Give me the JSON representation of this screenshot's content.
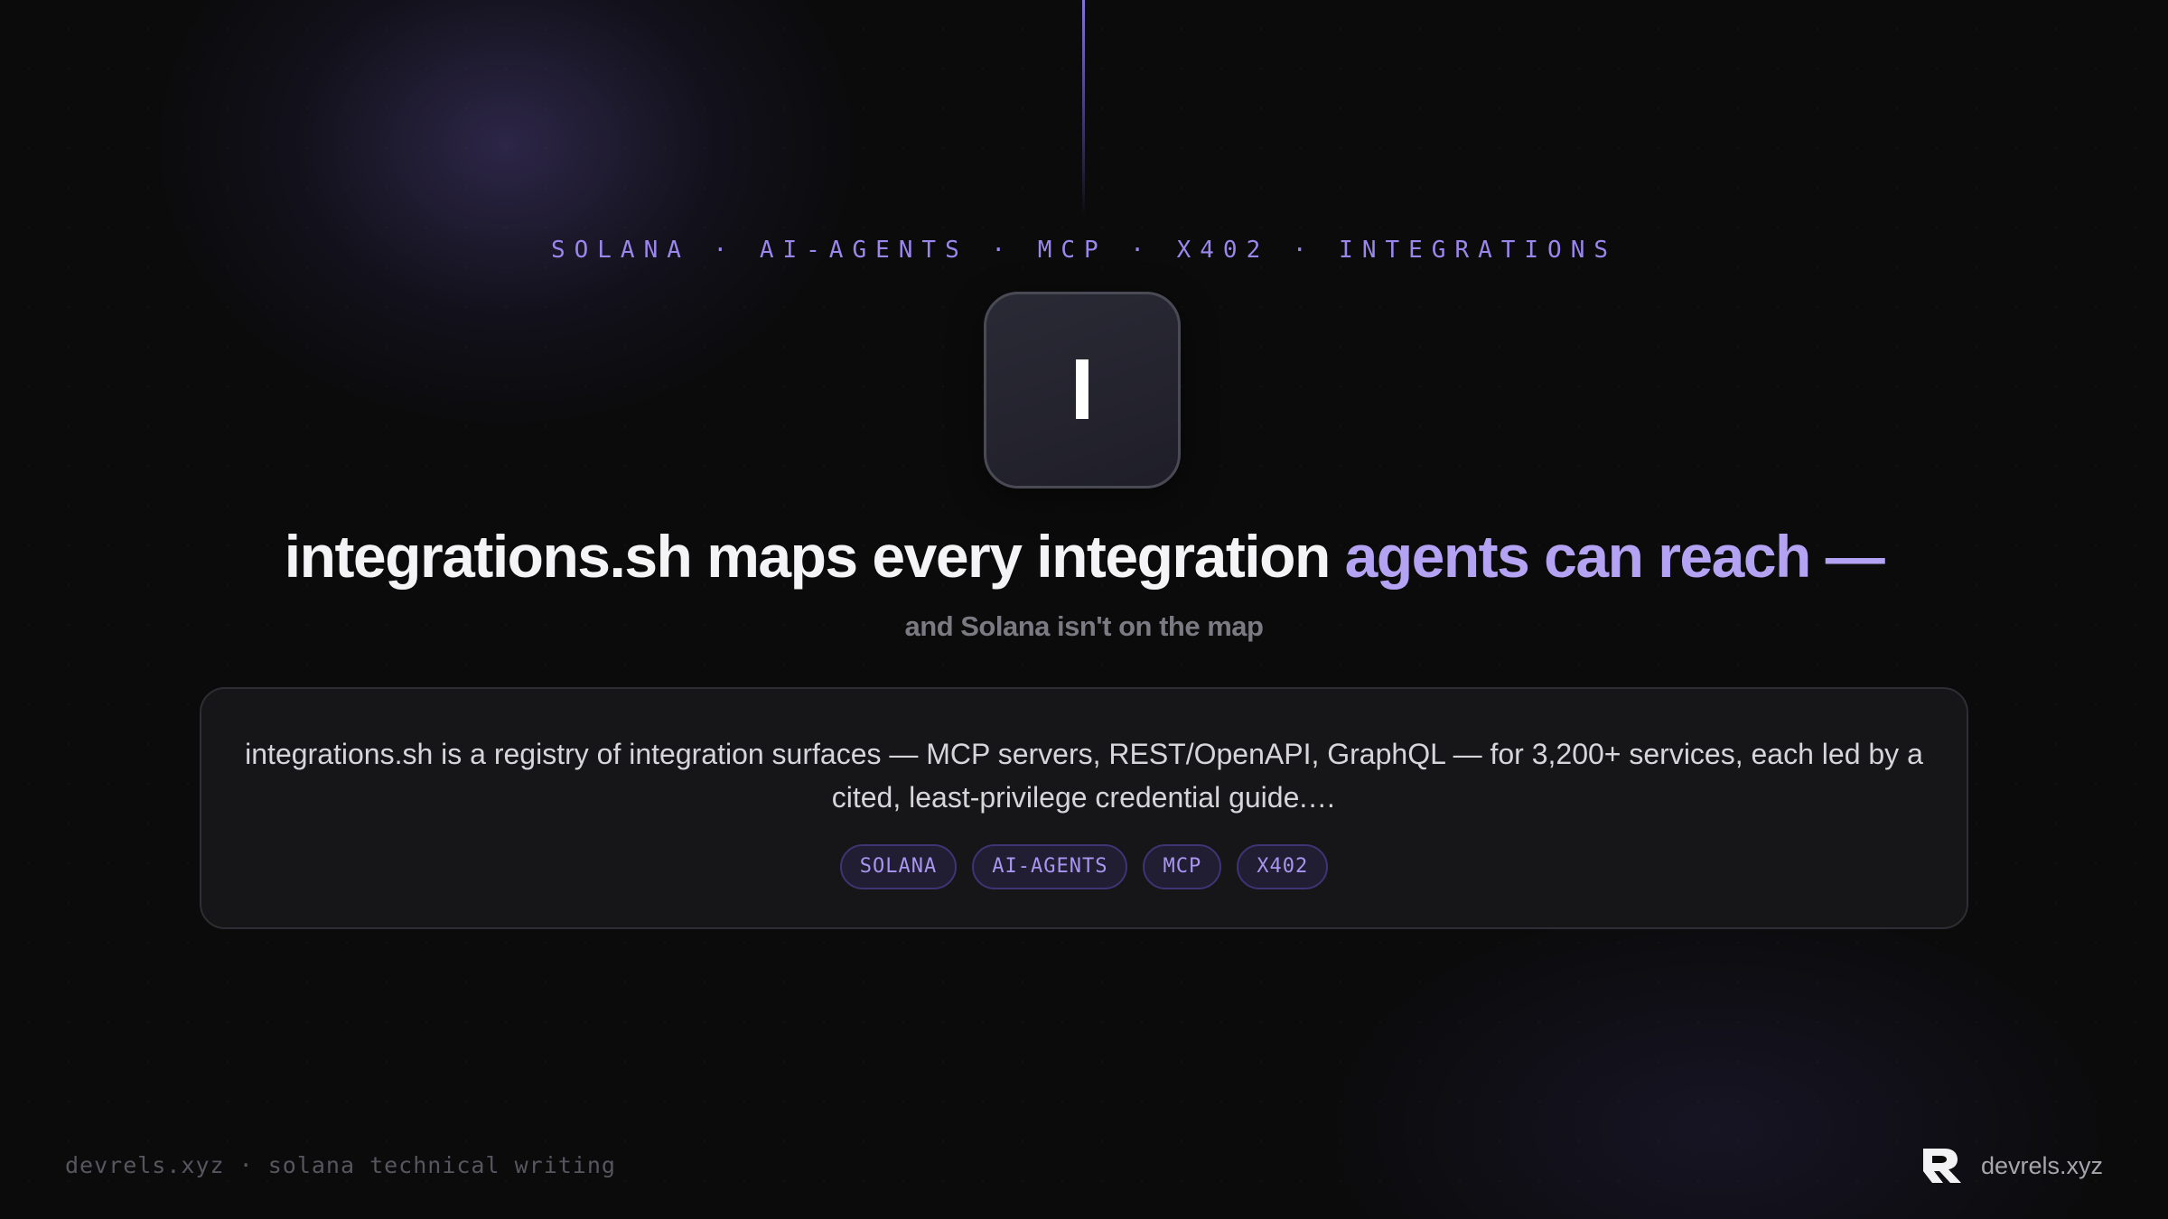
{
  "topics_line": "SOLANA · AI-AGENTS · MCP · X402 · INTEGRATIONS",
  "logo": {
    "letter": "I",
    "icon": "integrations-logo-tile"
  },
  "headline": {
    "main": "integrations.sh maps every integration ",
    "accent": "agents can reach —"
  },
  "subhead": "and Solana isn't on the map",
  "card": {
    "description": "integrations.sh is a registry of integration surfaces — MCP servers, REST/OpenAPI, GraphQL — for 3,200+ services, each led by a cited, least-privilege credential guide.…",
    "tags": [
      "SOLANA",
      "AI-AGENTS",
      "MCP",
      "X402"
    ]
  },
  "footer": {
    "left_text": "devrels.xyz · solana technical writing",
    "brand_name": "devrels.xyz",
    "brand_icon": "devrels-logo-icon"
  },
  "colors": {
    "accent_purple": "#9b86ec",
    "headline_accent": "#b4a2f2",
    "background": "#0b0b0c"
  }
}
